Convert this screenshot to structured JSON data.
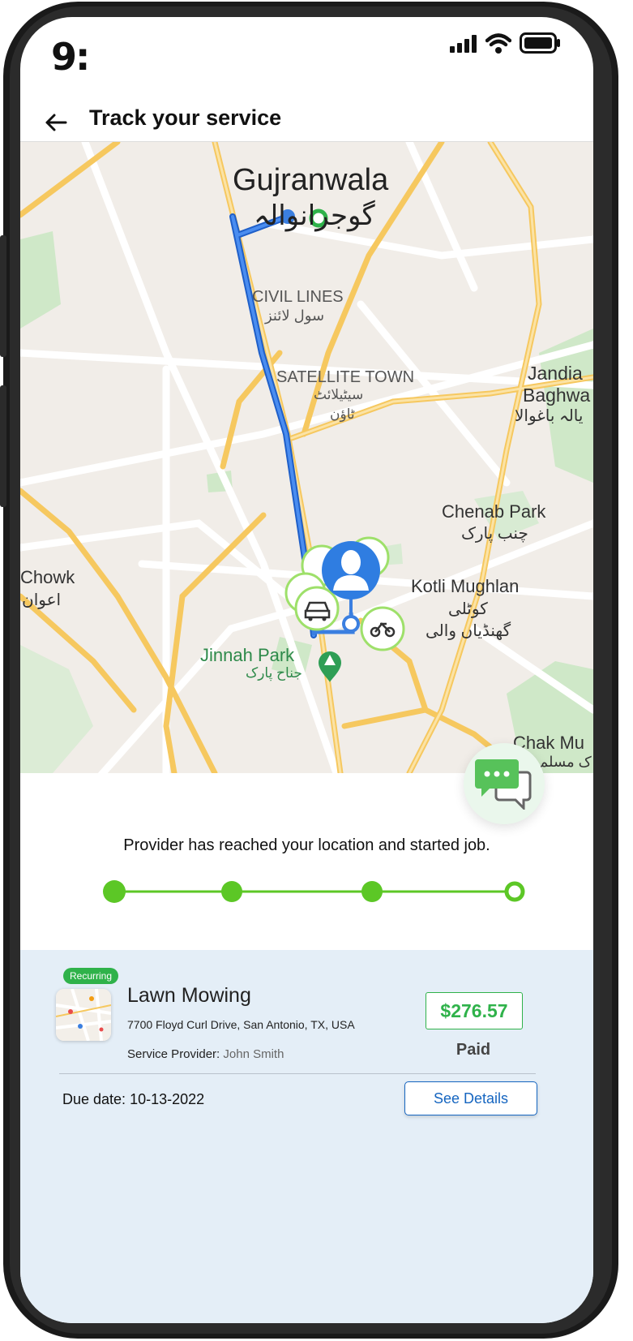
{
  "status_bar": {
    "time": "9:"
  },
  "header": {
    "title": "Track your service",
    "back_icon": "arrow-left-icon"
  },
  "map": {
    "labels": {
      "gujranwala": "Gujranwala",
      "gujranwala_urdu": "گوجرانوالہ",
      "civil_lines": "CIVIL LINES",
      "civil_lines_urdu": "سول لائنز",
      "satellite_town": "SATELLITE TOWN",
      "satellite_town_urdu_1": "سیٹیلائٹ",
      "satellite_town_urdu_2": "ٹاؤن",
      "jandiala_1": "Jandia",
      "jandiala_2": "Baghwa",
      "jandiala_urdu": "یالہ باغوالا",
      "chenab_park": "Chenab Park",
      "chenab_park_urdu": "چنب پارک",
      "chowk": "Chowk",
      "chowk_urdu": "اعوان",
      "kotli_mughlan": "Kotli Mughlan",
      "kotli_urdu_1": "کوٹلی",
      "kotli_urdu_2": "گھنڈیاں والی",
      "jinnah_park": "Jinnah Park",
      "jinnah_park_urdu": "جناح پارک",
      "chak_mu": "Chak Mu",
      "chak_mu_urdu": "ک مسلم"
    },
    "colors": {
      "route": "#3b7fe0",
      "road_major": "#f6c85f",
      "park": "#c9e6c4",
      "accent_green": "#7ad13f"
    }
  },
  "chat": {
    "icon": "chat-bubbles-icon"
  },
  "tracking": {
    "message": "Provider has reached your location and started job.",
    "steps_total": 4,
    "steps_completed": 3
  },
  "service": {
    "badge": "Recurring",
    "name": "Lawn Mowing",
    "address": "7700 Floyd Curl Drive, San Antonio, TX, USA",
    "provider_label": "Service Provider:",
    "provider_name": "John Smith",
    "price": "$276.57",
    "payment_status": "Paid",
    "due_label": "Due date:",
    "due_date": "10-13-2022",
    "details_button": "See Details"
  }
}
